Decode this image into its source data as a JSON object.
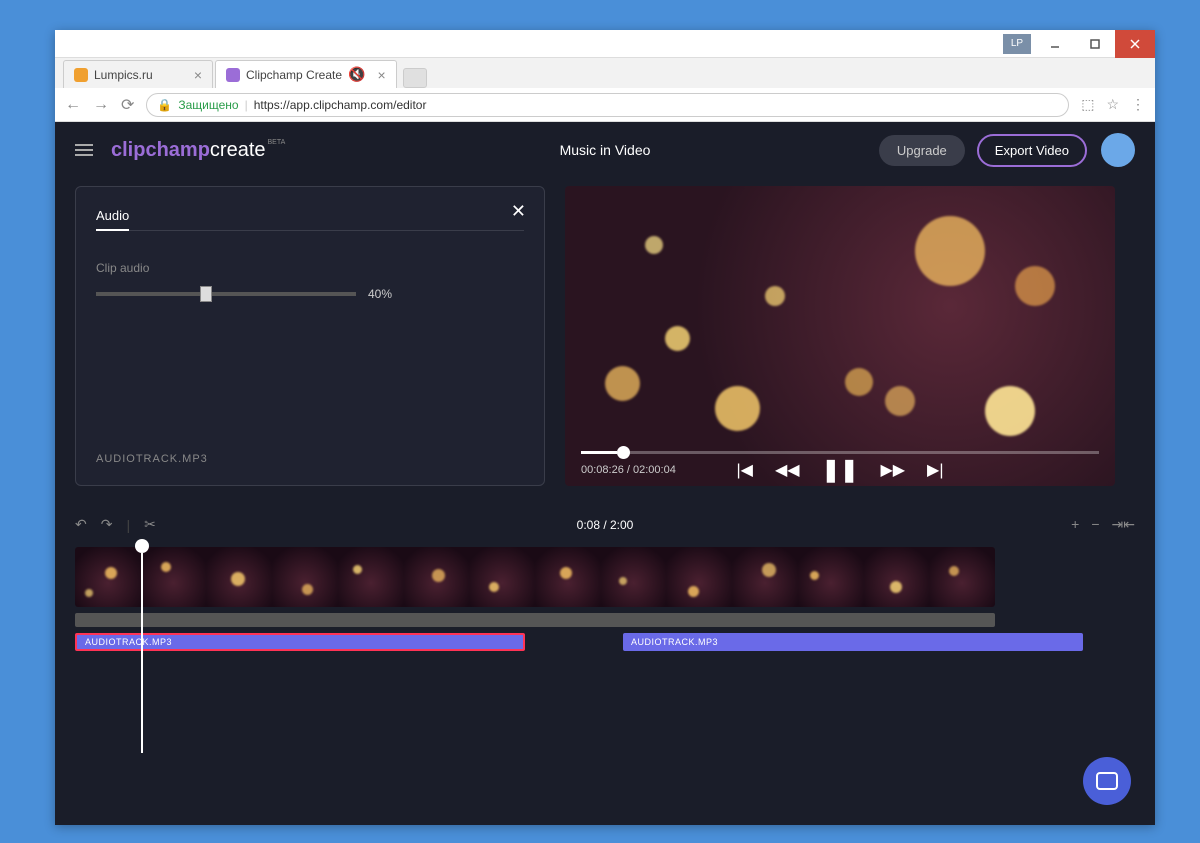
{
  "titlebar": {
    "badge": "LP"
  },
  "tabs": {
    "items": [
      {
        "label": "Lumpics.ru",
        "active": false
      },
      {
        "label": "Clipchamp Create",
        "active": true
      }
    ]
  },
  "addressbar": {
    "secure_label": "Защищено",
    "url": "https://app.clipchamp.com/editor"
  },
  "header": {
    "logo_part1": "clipchamp",
    "logo_part2": "create",
    "beta": "BETA",
    "doc_title": "Music in Video",
    "upgrade": "Upgrade",
    "export": "Export Video"
  },
  "audio_panel": {
    "tab_label": "Audio",
    "clip_label": "Clip audio",
    "volume_percent": 40,
    "volume_display": "40%",
    "filename": "AUDIOTRACK.MP3"
  },
  "preview": {
    "progress_percent": 7,
    "current_time": "00:08:26",
    "total_time": "02:00:04"
  },
  "timeline": {
    "position": "0:08 / 2:00",
    "audio_clips": [
      {
        "label": "AUDIOTRACK.MP3",
        "selected": true
      },
      {
        "label": "AUDIOTRACK.MP3",
        "selected": false
      }
    ]
  }
}
